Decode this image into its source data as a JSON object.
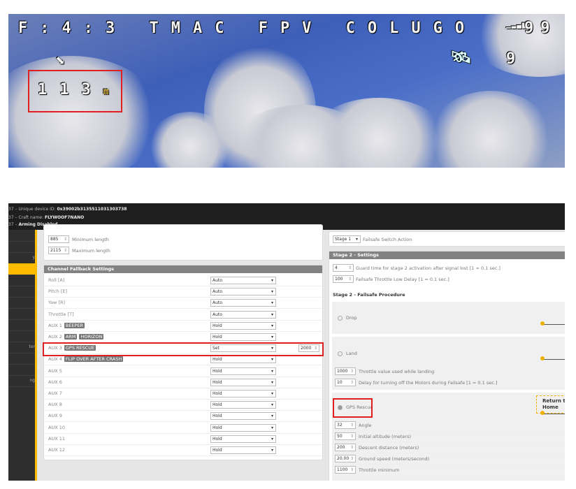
{
  "osd": {
    "top_line": "F:4:3 TMAC FPV COLUGO",
    "rssi": "99",
    "altitude": "113",
    "altitude_unit": "m",
    "sats": "9",
    "icons": [
      "home-arrow-icon",
      "satellite-icon",
      "signal-bars-icon"
    ]
  },
  "console": {
    "lines": [
      {
        "prefix": "37 – Unique device ID: ",
        "value": "0x39002b3135511031303738"
      },
      {
        "prefix": "37 – Craft name: ",
        "value": "FLYWOOF7NANO"
      },
      {
        "prefix": "37 – ",
        "value": "Arming Disabled"
      }
    ]
  },
  "sidebar": {
    "items": [
      "",
      "",
      "y",
      "",
      "",
      "",
      "",
      "",
      "",
      "",
      "ter",
      "",
      "",
      "ng"
    ],
    "active_index": 3,
    "accent": "#ffbb00"
  },
  "pulse": {
    "min_value": "885",
    "min_label": "Minimum length",
    "max_value": "2115",
    "max_label": "Maximum length"
  },
  "fallback": {
    "title": "Channel Fallback Settings",
    "rows": [
      {
        "label": "Roll [A]",
        "tags": [],
        "mode": "Auto"
      },
      {
        "label": "Pitch [E]",
        "tags": [],
        "mode": "Auto"
      },
      {
        "label": "Yaw [R]",
        "tags": [],
        "mode": "Auto"
      },
      {
        "label": "Throttle [T]",
        "tags": [],
        "mode": "Auto"
      },
      {
        "label": "AUX 1",
        "tags": [
          "BEEPER"
        ],
        "mode": "Hold"
      },
      {
        "label": "AUX 2",
        "tags": [
          "ARM",
          "HORIZON"
        ],
        "mode": "Hold"
      },
      {
        "label": "AUX 3",
        "tags": [
          "GPS RESCUE"
        ],
        "mode": "Set",
        "value": "2000"
      },
      {
        "label": "AUX 4",
        "tags": [
          "FLIP OVER AFTER CRASH"
        ],
        "mode": "Hold"
      },
      {
        "label": "AUX 5",
        "tags": [],
        "mode": "Hold"
      },
      {
        "label": "AUX 6",
        "tags": [],
        "mode": "Hold"
      },
      {
        "label": "AUX 7",
        "tags": [],
        "mode": "Hold"
      },
      {
        "label": "AUX 8",
        "tags": [],
        "mode": "Hold"
      },
      {
        "label": "AUX 9",
        "tags": [],
        "mode": "Hold"
      },
      {
        "label": "AUX 10",
        "tags": [],
        "mode": "Hold"
      },
      {
        "label": "AUX 11",
        "tags": [],
        "mode": "Hold"
      },
      {
        "label": "AUX 12",
        "tags": [],
        "mode": "Hold"
      }
    ]
  },
  "switch": {
    "value": "Stage 1",
    "label": "Failsafe Switch Action"
  },
  "stage2": {
    "title": "Stage 2 - Settings",
    "guard_value": "4",
    "guard_label": "Guard time for stage 2 activation after signal lost [1 = 0.1 sec.]",
    "delay_value": "100",
    "delay_label": "Failsafe Throttle Low Delay [1 = 0.1 sec.]"
  },
  "procedure": {
    "title": "Stage 2 - Failsafe Procedure",
    "drop": "Drop",
    "land": "Land",
    "land_throttle_value": "1000",
    "land_throttle_label": "Throttle value used while landing",
    "land_delay_value": "10",
    "land_delay_label": "Delay for turning off the Motors during Failsafe [1 = 0.1 sec.]",
    "gps": "GPS Rescue",
    "rth_line1": "Return to-",
    "rth_line2": "Home",
    "gps_fields": [
      {
        "value": "32",
        "label": "Angle"
      },
      {
        "value": "50",
        "label": "Initial altitude (meters)"
      },
      {
        "value": "200",
        "label": "Descent distance (meters)"
      },
      {
        "value": "20.00",
        "label": "Ground speed (meters/second)"
      },
      {
        "value": "1100",
        "label": "Throttle minimum"
      }
    ],
    "selected": "GPS Rescue"
  }
}
